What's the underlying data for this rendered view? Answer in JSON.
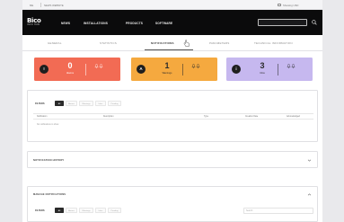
{
  "topbar": {
    "item1": "ME",
    "item2": "NEWS WEBSITE",
    "checkbox_label": "Showing USD"
  },
  "brand": {
    "name": "Bico",
    "tagline": "INFO HUB"
  },
  "nav": {
    "items": [
      "NEWS",
      "INSTALLATIONS",
      "PRODUCTS",
      "SOFTWARE"
    ]
  },
  "tabs": [
    {
      "label": "GENERAL"
    },
    {
      "label": "STATISTICS"
    },
    {
      "label": "NOTIFICATIONS"
    },
    {
      "label": "PARAMETERS"
    },
    {
      "label": "TECHNICAL INFORMATION"
    }
  ],
  "cards": [
    {
      "count": "0",
      "label": "Alarms",
      "icon": "!",
      "bg": "#f26b54",
      "fg": "#ffffff"
    },
    {
      "count": "1",
      "label": "Warnings",
      "icon": "A",
      "bg": "#f5a93f",
      "fg": "#2b2b2b"
    },
    {
      "count": "3",
      "label": "Infos",
      "icon": "i",
      "bg": "#c6b8ef",
      "fg": "#2b2b2b"
    }
  ],
  "filters": {
    "label": "FILTERS",
    "buttons": [
      "All",
      "Alarms",
      "Warnings",
      "Infos",
      "Pending"
    ]
  },
  "table": {
    "columns": [
      "Notification",
      "Description",
      "Type",
      "Creation Date",
      "Acknowledged"
    ],
    "empty_text": "No notifications to show"
  },
  "history": {
    "title": "NOTIFICATION HISTORY"
  },
  "manage": {
    "title": "MANAGE NOTIFICATIONS",
    "filters_label": "FILTERS",
    "buttons": [
      "All",
      "Alarms",
      "Warnings",
      "Infos",
      "Pending"
    ],
    "search_placeholder": "Search"
  },
  "colors": {
    "navbar": "#0b0b0c",
    "alarm": "#f26b54",
    "warning": "#f5a93f",
    "info": "#c6b8ef"
  }
}
